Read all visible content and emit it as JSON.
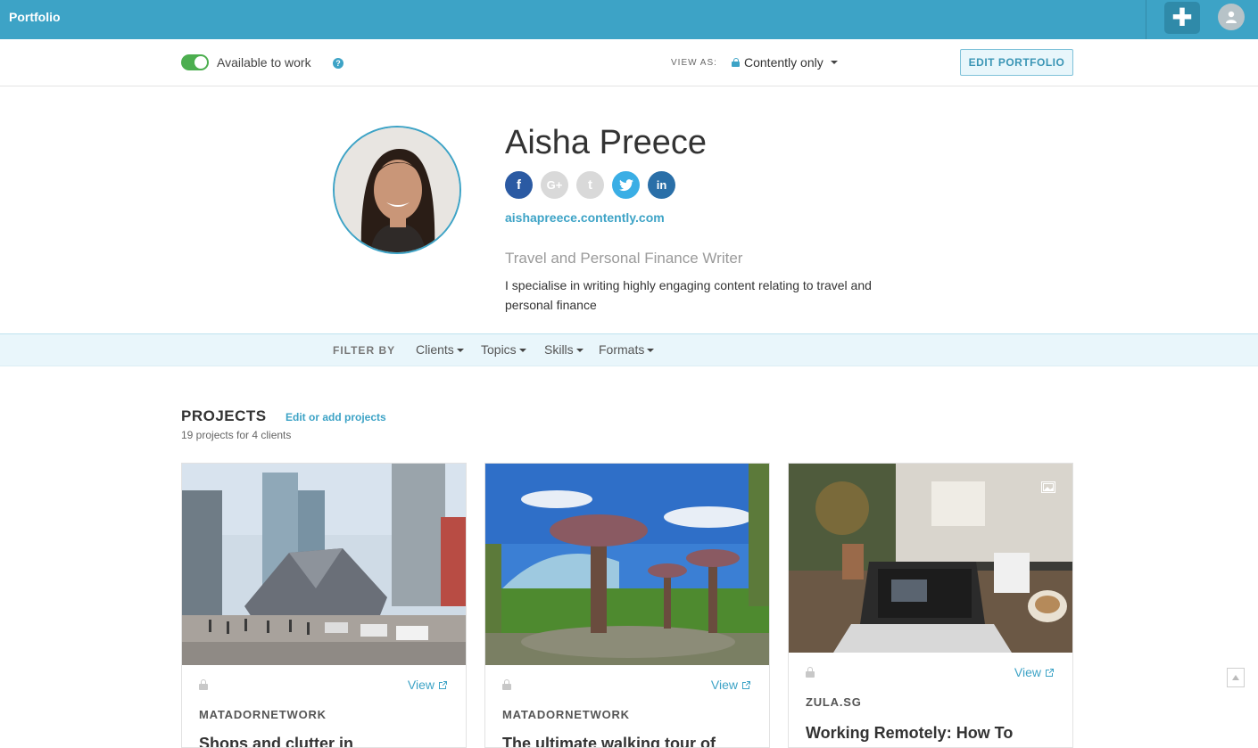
{
  "topbar": {
    "app_title": "Portfolio",
    "plus_icon": "plus-icon",
    "user_icon": "user-icon",
    "accent_color": "#3da3c6"
  },
  "subbar": {
    "availability_label": "Available to work",
    "availability_on": true,
    "help_icon": "question-icon",
    "view_as_label": "VIEW AS:",
    "view_as_value": "Contently only",
    "edit_portfolio_label": "EDIT PORTFOLIO"
  },
  "profile": {
    "name": "Aisha Preece",
    "url": "aishapreece.contently.com",
    "tagline": "Travel and Personal Finance Writer",
    "bio": "I specialise in writing highly engaging content relating to travel and personal finance",
    "social": [
      {
        "icon": "facebook-icon",
        "glyph": "f",
        "color": "#2b5aa3"
      },
      {
        "icon": "google-plus-icon",
        "glyph": "G+",
        "color": "#d9d9d9"
      },
      {
        "icon": "tumblr-icon",
        "glyph": "t",
        "color": "#d9d9d9"
      },
      {
        "icon": "twitter-icon",
        "glyph": "🐦",
        "color": "#3aaee5"
      },
      {
        "icon": "linkedin-icon",
        "glyph": "in",
        "color": "#2a6fa8"
      }
    ]
  },
  "filter": {
    "label": "FILTER BY",
    "items": [
      "Clients",
      "Topics",
      "Skills",
      "Formats"
    ]
  },
  "projects": {
    "title": "PROJECTS",
    "edit_link": "Edit or add projects",
    "count_text": "19 projects for 4 clients",
    "cards": [
      {
        "client": "MATADORNETWORK",
        "view_label": "View",
        "title": "Shops and clutter in"
      },
      {
        "client": "MATADORNETWORK",
        "view_label": "View",
        "title": "The ultimate walking tour of"
      },
      {
        "client": "ZULA.SG",
        "view_label": "View",
        "title": "Working Remotely: How To"
      }
    ]
  }
}
